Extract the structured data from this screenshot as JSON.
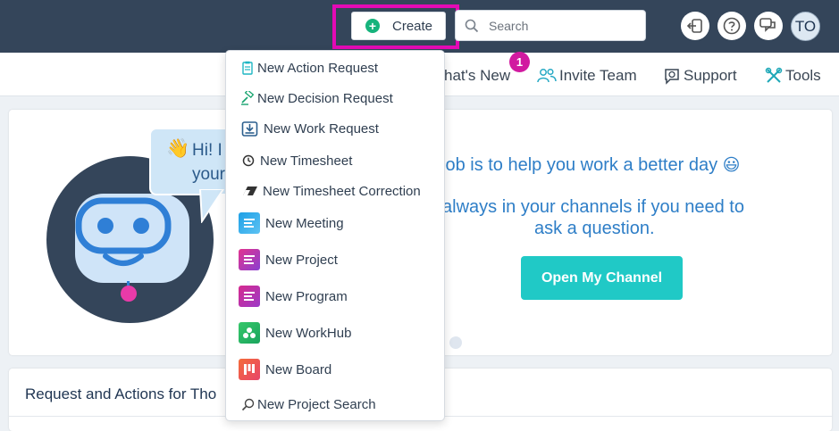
{
  "topbar": {
    "create_label": "Create",
    "search_placeholder": "Search",
    "avatar_initials": "TO",
    "highlight_color": "#e40ab5"
  },
  "navbar": {
    "whats_new": "hat's New",
    "whats_new_badge": "1",
    "invite_team": "Invite Team",
    "support": "Support",
    "tools": "Tools"
  },
  "hero": {
    "bubble_line1": "Hi! I",
    "bubble_line2": "your",
    "headline1": "job is to help you work a better day",
    "headline2": "always in your channels if you need to",
    "headline3": "ask a question.",
    "open_button": "Open My Channel"
  },
  "section": {
    "title": "Request and Actions for Tho"
  },
  "menu": {
    "items": [
      {
        "label": "New Action Request",
        "icon": "clipboard-icon"
      },
      {
        "label": "New Decision Request",
        "icon": "gavel-icon"
      },
      {
        "label": "New Work Request",
        "icon": "inbox-download-icon"
      },
      {
        "label": "New Timesheet",
        "icon": "clock-icon"
      },
      {
        "label": "New Timesheet Correction",
        "icon": "eraser-icon"
      },
      {
        "label": "New Meeting",
        "icon": "meeting-icon"
      },
      {
        "label": "New Project",
        "icon": "project-icon"
      },
      {
        "label": "New Program",
        "icon": "program-icon"
      },
      {
        "label": "New WorkHub",
        "icon": "workhub-icon"
      },
      {
        "label": "New Board",
        "icon": "board-icon"
      },
      {
        "label": "New Project Search",
        "icon": "search-icon"
      }
    ]
  }
}
